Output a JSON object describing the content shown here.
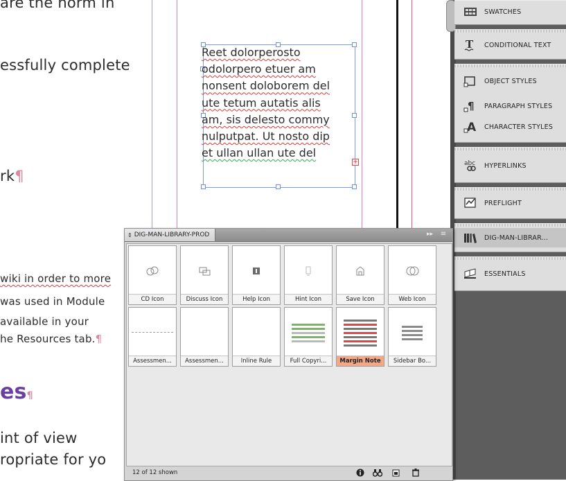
{
  "document": {
    "text_left": [
      {
        "text": "are the norm in",
        "mark": ""
      },
      {
        "text": "essfully complete",
        "mark": ""
      },
      {
        "text": "rk",
        "mark": "¶"
      },
      {
        "text": "wiki in order to more",
        "mark": ""
      },
      {
        "text": "was used in Module",
        "mark": ""
      },
      {
        "text": "available in your",
        "mark": ""
      },
      {
        "text": "he Resources tab.",
        "mark": "¶"
      },
      {
        "text": "es",
        "mark": "¶"
      },
      {
        "text": "int of view",
        "mark": ""
      },
      {
        "text": "ropriate for yo",
        "mark": ""
      }
    ],
    "frame_lines": [
      "Reet dolorperosto",
      "odolorpero etuer am",
      "nonsent doloborem del",
      "ute tetum autatis alis",
      "am, sis delesto commy",
      "nulputpat. Ut nosto dip",
      "et ullan ullan ute del"
    ],
    "overset_symbol": "+"
  },
  "dock": {
    "items": [
      {
        "label": "SWATCHES",
        "icon": "swatches-icon"
      },
      {
        "label": "CONDITIONAL TEXT",
        "icon": "conditional-text-icon"
      },
      {
        "label": "OBJECT STYLES",
        "icon": "object-styles-icon"
      },
      {
        "label": "PARAGRAPH STYLES",
        "icon": "paragraph-styles-icon"
      },
      {
        "label": "CHARACTER STYLES",
        "icon": "character-styles-icon"
      },
      {
        "label": "HYPERLINKS",
        "icon": "hyperlinks-icon"
      },
      {
        "label": "PREFLIGHT",
        "icon": "preflight-icon"
      },
      {
        "label": "DIG-MAN-LIBRAR...",
        "icon": "library-icon"
      },
      {
        "label": "ESSENTIALS",
        "icon": "workspace-icon"
      }
    ]
  },
  "library": {
    "title": "DIG-MAN-LIBRARY-PROD",
    "collapse_glyph": "▸▸",
    "menu_glyph": "≡",
    "items": [
      {
        "name": "CD Icon",
        "selected": false
      },
      {
        "name": "Discuss Icon",
        "selected": false
      },
      {
        "name": "Help Icon",
        "selected": false
      },
      {
        "name": "Hint Icon",
        "selected": false
      },
      {
        "name": "Save Icon",
        "selected": false
      },
      {
        "name": "Web Icon",
        "selected": false
      },
      {
        "name": "Assessmen...",
        "selected": false
      },
      {
        "name": "Assessmen...",
        "selected": false
      },
      {
        "name": "Inline Rule",
        "selected": false
      },
      {
        "name": "Full Copyri...",
        "selected": false
      },
      {
        "name": "Margin Note",
        "selected": true
      },
      {
        "name": "Sidebar Bo...",
        "selected": false
      }
    ],
    "status": "12 of 12 shown",
    "status_icons": [
      "info-icon",
      "binoculars-icon",
      "new-item-icon",
      "delete-icon"
    ]
  },
  "colors": {
    "selection_highlight": "#f3a888",
    "heading_purple": "#6b3fa0",
    "frame_border": "#7a9be0",
    "overset_red": "#e0454e"
  }
}
